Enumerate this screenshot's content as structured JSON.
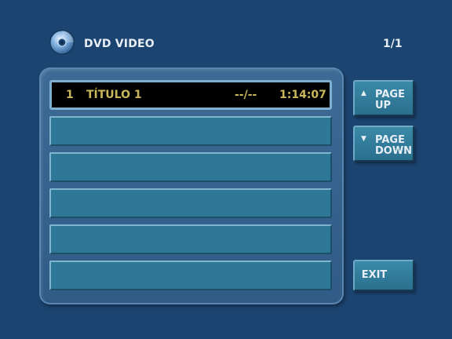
{
  "header": {
    "title": "DVD VIDEO",
    "page_indicator": "1/1"
  },
  "list": {
    "rows": [
      {
        "number": "1",
        "title": "TÍTULO 1",
        "chapter": "--/--",
        "duration": "1:14:07",
        "selected": true
      },
      {
        "number": "",
        "title": "",
        "chapter": "",
        "duration": "",
        "selected": false
      },
      {
        "number": "",
        "title": "",
        "chapter": "",
        "duration": "",
        "selected": false
      },
      {
        "number": "",
        "title": "",
        "chapter": "",
        "duration": "",
        "selected": false
      },
      {
        "number": "",
        "title": "",
        "chapter": "",
        "duration": "",
        "selected": false
      },
      {
        "number": "",
        "title": "",
        "chapter": "",
        "duration": "",
        "selected": false
      }
    ]
  },
  "buttons": {
    "page_up": {
      "arrow": "▲",
      "label": "PAGE\nUP"
    },
    "page_down": {
      "arrow": "▼",
      "label": "PAGE\nDOWN"
    },
    "exit": {
      "label": "EXIT"
    }
  },
  "colors": {
    "background": "#1c4470",
    "row": "#2f7796",
    "selected_row": "#000000",
    "row_text": "#c9b85a"
  },
  "icons": {
    "header": "dvd-disc-icon"
  }
}
